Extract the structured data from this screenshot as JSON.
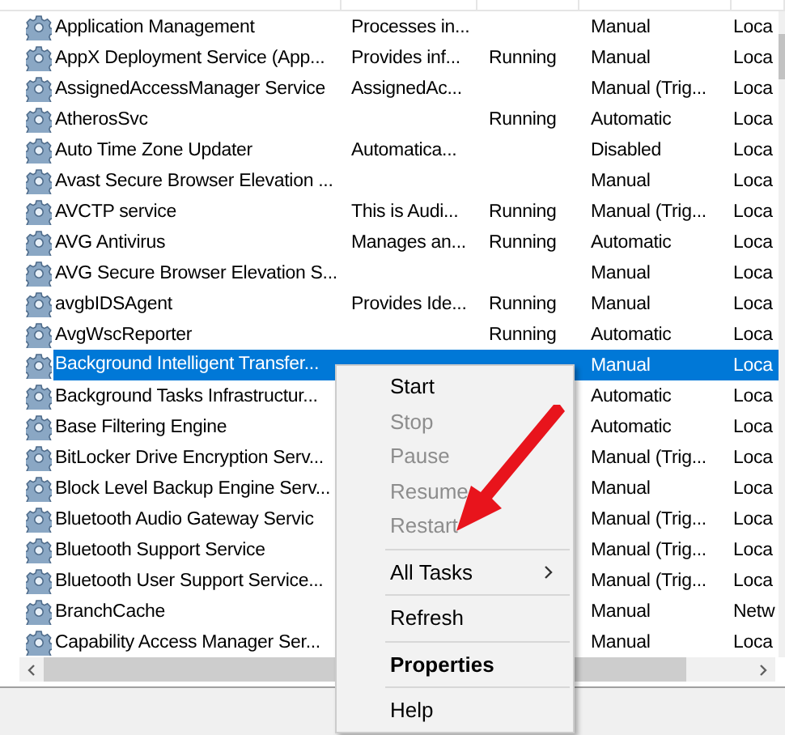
{
  "services": [
    {
      "name": "Application Management",
      "description": "Processes in...",
      "startup": "Manual",
      "logon": "Loca",
      "selected": false
    },
    {
      "name": "AppX Deployment Service (App...",
      "description": "Provides inf...",
      "status": "Running",
      "startup": "Manual",
      "logon": "Loca",
      "selected": false
    },
    {
      "name": "AssignedAccessManager Service",
      "description": "AssignedAc...",
      "startup": "Manual (Trig...",
      "logon": "Loca",
      "selected": false
    },
    {
      "name": "AtherosSvc",
      "status": "Running",
      "startup": "Automatic",
      "logon": "Loca",
      "selected": false
    },
    {
      "name": "Auto Time Zone Updater",
      "description": "Automatica...",
      "startup": "Disabled",
      "logon": "Loca",
      "selected": false
    },
    {
      "name": "Avast Secure Browser Elevation ...",
      "startup": "Manual",
      "logon": "Loca",
      "selected": false
    },
    {
      "name": "AVCTP service",
      "description": "This is Audi...",
      "status": "Running",
      "startup": "Manual (Trig...",
      "logon": "Loca",
      "selected": false
    },
    {
      "name": "AVG Antivirus",
      "description": "Manages an...",
      "status": "Running",
      "startup": "Automatic",
      "logon": "Loca",
      "selected": false
    },
    {
      "name": "AVG Secure Browser Elevation S...",
      "startup": "Manual",
      "logon": "Loca",
      "selected": false
    },
    {
      "name": "avgbIDSAgent",
      "description": "Provides Ide...",
      "status": "Running",
      "startup": "Manual",
      "logon": "Loca",
      "selected": false
    },
    {
      "name": "AvgWscReporter",
      "status": "Running",
      "startup": "Automatic",
      "logon": "Loca",
      "selected": false
    },
    {
      "name": "Background Intelligent Transfer...",
      "startup": "Manual",
      "logon": "Loca",
      "selected": true
    },
    {
      "name": "Background Tasks Infrastructur...",
      "startup": "Automatic",
      "logon": "Loca",
      "selected": false
    },
    {
      "name": "Base Filtering Engine",
      "startup": "Automatic",
      "logon": "Loca",
      "selected": false
    },
    {
      "name": "BitLocker Drive Encryption Serv...",
      "startup": "Manual (Trig...",
      "logon": "Loca",
      "selected": false
    },
    {
      "name": "Block Level Backup Engine Serv...",
      "startup": "Manual",
      "logon": "Loca",
      "selected": false
    },
    {
      "name": "Bluetooth Audio Gateway Servic",
      "startup": "Manual (Trig...",
      "logon": "Loca",
      "selected": false
    },
    {
      "name": "Bluetooth Support Service",
      "startup": "Manual (Trig...",
      "logon": "Loca",
      "selected": false
    },
    {
      "name": "Bluetooth User Support Service...",
      "startup": "Manual (Trig...",
      "logon": "Loca",
      "selected": false
    },
    {
      "name": "BranchCache",
      "startup": "Manual",
      "logon": "Netw",
      "selected": false
    },
    {
      "name": "Capability Access Manager Ser...",
      "startup": "Manual",
      "logon": "Loca",
      "selected": false
    }
  ],
  "context_menu": [
    {
      "kind": "item",
      "label": "Start",
      "disabled": false,
      "default": false
    },
    {
      "kind": "item",
      "label": "Stop",
      "disabled": true,
      "default": false
    },
    {
      "kind": "item",
      "label": "Pause",
      "disabled": true,
      "default": false
    },
    {
      "kind": "item",
      "label": "Resume",
      "disabled": true,
      "default": false
    },
    {
      "kind": "item",
      "label": "Restart",
      "disabled": true,
      "default": false
    },
    {
      "kind": "separator"
    },
    {
      "kind": "submenu",
      "label": "All Tasks",
      "disabled": false,
      "default": false
    },
    {
      "kind": "separator"
    },
    {
      "kind": "item",
      "label": "Refresh",
      "disabled": false,
      "default": false
    },
    {
      "kind": "separator"
    },
    {
      "kind": "item",
      "label": "Properties",
      "disabled": false,
      "default": true
    },
    {
      "kind": "separator"
    },
    {
      "kind": "item",
      "label": "Help",
      "disabled": false,
      "default": false
    }
  ]
}
